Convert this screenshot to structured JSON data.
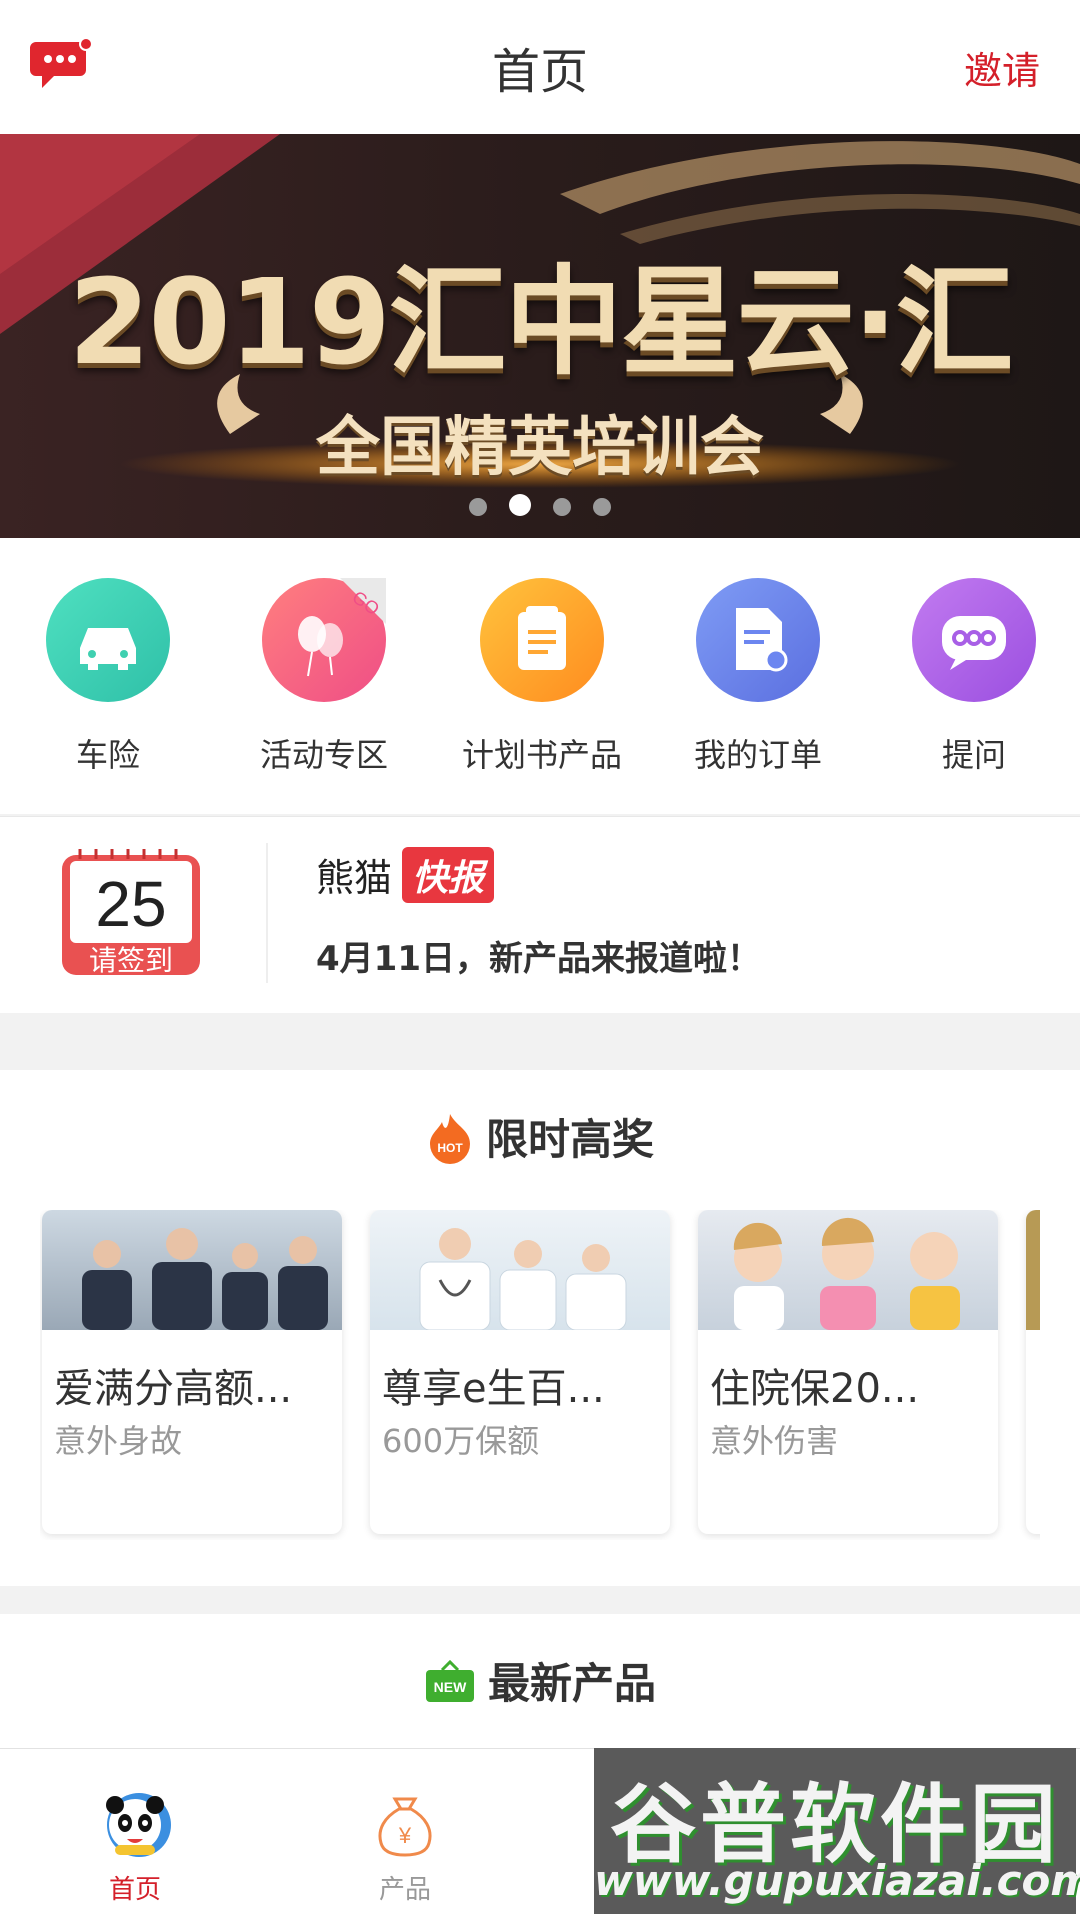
{
  "header": {
    "title": "首页",
    "invite": "邀请"
  },
  "banner": {
    "line1": "2019汇中星云·汇",
    "line2": "全国精英培训会",
    "dot_count": 4,
    "active_dot": 2
  },
  "quick": [
    {
      "label": "车险",
      "icon": "car-icon",
      "color": "#3fd0b0"
    },
    {
      "label": "活动专区",
      "icon": "balloon-icon",
      "color": "#f45a7a"
    },
    {
      "label": "计划书产品",
      "icon": "clipboard-icon",
      "color": "#ffa733"
    },
    {
      "label": "我的订单",
      "icon": "document-icon",
      "color": "#6c86f0"
    },
    {
      "label": "提问",
      "icon": "chat-icon",
      "color": "#a85fe6"
    }
  ],
  "news": {
    "day": "25",
    "checkin": "请签到",
    "brand": "熊猫",
    "badge": "快报",
    "headline": "4月11日，新产品来报道啦！"
  },
  "hot": {
    "badge": "HOT",
    "title": "限时高奖",
    "cards": [
      {
        "title": "爱满分高额...",
        "subtitle": "意外身故"
      },
      {
        "title": "尊享e生百...",
        "subtitle": "600万保额"
      },
      {
        "title": "住院保20...",
        "subtitle": "意外伤害"
      }
    ]
  },
  "newest": {
    "badge": "NEW",
    "title": "最新产品"
  },
  "tabs": [
    {
      "label": "首页",
      "icon": "panda-icon",
      "active": true
    },
    {
      "label": "产品",
      "icon": "money-bag-icon",
      "active": false
    }
  ],
  "watermark": {
    "text": "谷普软件园",
    "url": "www.gupuxiazai.com"
  },
  "colors": {
    "accent": "#d4202a",
    "tab_active": "#d4202a",
    "tab_inactive": "#999999"
  }
}
